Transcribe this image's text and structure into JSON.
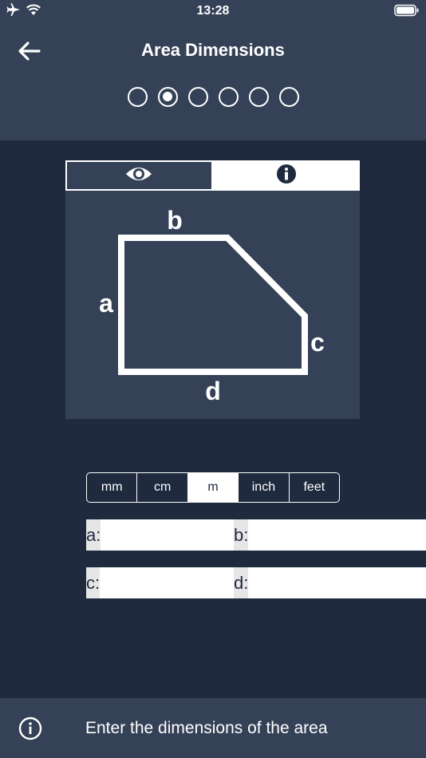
{
  "status_bar": {
    "time": "13:28",
    "icons": [
      "airplane-icon",
      "wifi-icon",
      "battery-icon"
    ]
  },
  "header": {
    "title": "Area Dimensions",
    "back_icon": "arrow-left-icon",
    "steps": {
      "total": 6,
      "current": 2
    }
  },
  "illustration": {
    "tabs": [
      {
        "icon": "eye-icon",
        "selected": true
      },
      {
        "icon": "info-icon",
        "selected": false
      }
    ],
    "labels": {
      "a": "a",
      "b": "b",
      "c": "c",
      "d": "d"
    }
  },
  "units": {
    "options": [
      "mm",
      "cm",
      "m",
      "inch",
      "feet"
    ],
    "selected": "m"
  },
  "fields": {
    "a": {
      "label": "a:",
      "value": ""
    },
    "b": {
      "label": "b:",
      "value": ""
    },
    "c": {
      "label": "c:",
      "value": ""
    },
    "d": {
      "label": "d:",
      "value": ""
    }
  },
  "footer": {
    "icon": "info-circle-icon",
    "text": "Enter the dimensions of the area"
  },
  "colors": {
    "background": "#1f2a3e",
    "panel": "#354157",
    "foreground": "#ffffff"
  }
}
